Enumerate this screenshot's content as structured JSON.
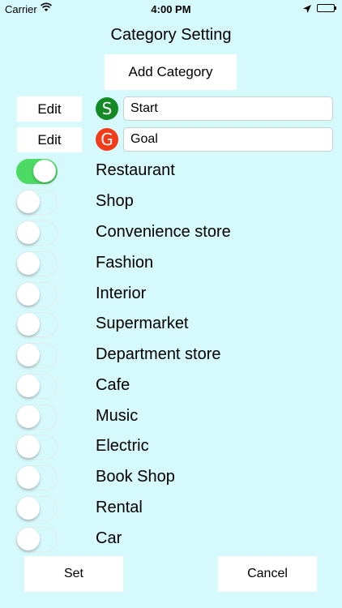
{
  "status_bar": {
    "carrier": "Carrier",
    "time": "4:00 PM"
  },
  "title": "Category Setting",
  "add_category_label": "Add Category",
  "edit_label": "Edit",
  "start": {
    "badge": "S",
    "value": "Start",
    "color": "#138a24"
  },
  "goal": {
    "badge": "G",
    "value": "Goal",
    "color": "#f23a18"
  },
  "categories": [
    {
      "label": "Restaurant",
      "on": true
    },
    {
      "label": "Shop",
      "on": false
    },
    {
      "label": "Convenience store",
      "on": false
    },
    {
      "label": "Fashion",
      "on": false
    },
    {
      "label": "Interior",
      "on": false
    },
    {
      "label": "Supermarket",
      "on": false
    },
    {
      "label": "Department store",
      "on": false
    },
    {
      "label": "Cafe",
      "on": false
    },
    {
      "label": "Music",
      "on": false
    },
    {
      "label": "Electric",
      "on": false
    },
    {
      "label": "Book Shop",
      "on": false
    },
    {
      "label": "Rental",
      "on": false
    },
    {
      "label": "Car",
      "on": false
    }
  ],
  "set_label": "Set",
  "cancel_label": "Cancel",
  "colors": {
    "background": "#d6f9fb",
    "toggle_on": "#4cd964"
  }
}
